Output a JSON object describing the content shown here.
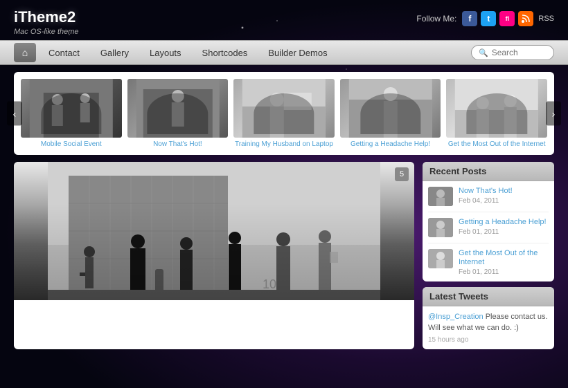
{
  "site": {
    "title": "iTheme2",
    "tagline": "Mac OS-like theme"
  },
  "header": {
    "follow_label": "Follow Me:",
    "rss_text": "RSS",
    "social_icons": [
      {
        "name": "facebook",
        "label": "f"
      },
      {
        "name": "twitter",
        "label": "t"
      },
      {
        "name": "flickr",
        "label": "fl"
      },
      {
        "name": "rss",
        "label": "rss"
      }
    ]
  },
  "navbar": {
    "home_icon": "⌂",
    "items": [
      {
        "label": "Contact"
      },
      {
        "label": "Gallery"
      },
      {
        "label": "Layouts"
      },
      {
        "label": "Shortcodes"
      },
      {
        "label": "Builder Demos"
      }
    ],
    "search_placeholder": "Search"
  },
  "slider": {
    "prev_icon": "‹",
    "next_icon": "›",
    "slides": [
      {
        "caption": "Mobile Social Event"
      },
      {
        "caption": "Now That's Hot!"
      },
      {
        "caption": "Training My Husband on Laptop"
      },
      {
        "caption": "Getting a Headache Help!"
      },
      {
        "caption": "Get the Most Out of the Internet"
      }
    ]
  },
  "main_post": {
    "comment_count": "5"
  },
  "sidebar": {
    "recent_posts_title": "Recent Posts",
    "posts": [
      {
        "title": "Now That's Hot!",
        "date": "Feb 04, 2011"
      },
      {
        "title": "Getting a Headache Help!",
        "date": "Feb 01, 2011"
      },
      {
        "title": "Get the Most Out of the Internet",
        "date": "Feb 01, 2011"
      }
    ],
    "tweets_title": "Latest Tweets",
    "tweet": {
      "handle": "@Insp_Creation",
      "text": " Please contact us. Will see what we can do. :)",
      "time": "15 hours ago"
    }
  }
}
